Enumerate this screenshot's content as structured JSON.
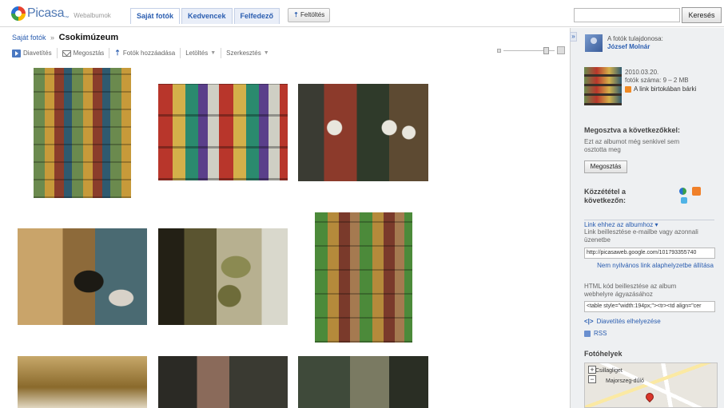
{
  "brand": {
    "logo_word": "Picasa",
    "logo_tm": "™",
    "logo_sub": "Webalbumok"
  },
  "tabs": [
    {
      "label": "Saját fotók",
      "active": true
    },
    {
      "label": "Kedvencek",
      "active": false
    },
    {
      "label": "Felfedező",
      "active": false
    }
  ],
  "upload": {
    "icon": "upload-arrow-icon",
    "label": "Feltöltés"
  },
  "search": {
    "placeholder": "",
    "value": "",
    "button_label": "Keresés"
  },
  "breadcrumb": {
    "parent": "Saját fotók",
    "separator": "»",
    "current": "Csokimúzeum"
  },
  "toolbar": {
    "slideshow": "Diavetítés",
    "share": "Megosztás",
    "add_photos": "Fotók hozzáadása",
    "download": "Letöltés",
    "edit": "Szerkesztés"
  },
  "owner": {
    "label": "A fotók tulajdonosa:",
    "name": "József Molnár"
  },
  "album_info": {
    "date": "2010.03.20.",
    "count": "fotók száma: 9 – 2 MB",
    "visibility": "A link birtokában bárki"
  },
  "shared": {
    "title": "Megosztva a következőkkel:",
    "description": "Ezt az albumot még senkivel sem osztotta meg",
    "button": "Megosztás"
  },
  "publish": {
    "title": "Közzététel a következőn:"
  },
  "link": {
    "toggle": "Link ehhez az albumhoz ▾",
    "description": "Link beillesztése e-mailbe vagy azonnali üzenetbe",
    "value": "http://picasaweb.google.com/101793355740",
    "reset": "Nem nyilvános link alaphelyzetbe állítása"
  },
  "html_embed": {
    "description": "HTML kód beillesztése az album webhelyre ágyazásához",
    "value": "<table style=\"width:194px;\"><tr><td align=\"cer",
    "embed_slideshow": "Diavetítés elhelyezése",
    "embed_code_glyph": "<|>"
  },
  "rss": {
    "label": "RSS"
  },
  "places": {
    "title": "Fotóhelyek",
    "zoom_in": "+",
    "zoom_out": "−",
    "labels": [
      "Csillagliget",
      "Majorszeg-dűlő"
    ]
  },
  "collapse_glyph": "»",
  "photos": [
    "photo-1",
    "photo-2",
    "photo-3",
    "photo-4",
    "photo-5",
    "photo-6",
    "photo-7",
    "photo-8",
    "photo-9"
  ]
}
